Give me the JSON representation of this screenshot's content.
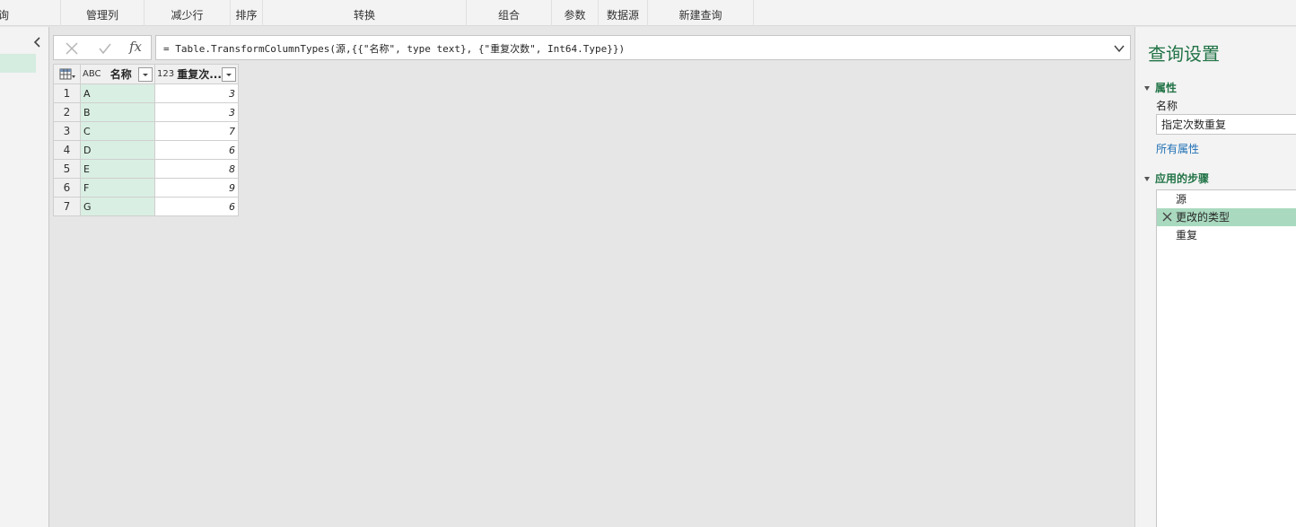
{
  "ribbon": {
    "groups": [
      "询",
      "管理列",
      "减少行",
      "排序",
      "转换",
      "组合",
      "参数",
      "数据源",
      "新建查询"
    ]
  },
  "formula_bar": {
    "formula": "= Table.TransformColumnTypes(源,{{\"名称\", type text}, {\"重复次数\", Int64.Type}})",
    "fx_label": "fx"
  },
  "grid": {
    "columns": [
      {
        "label": "名称",
        "type_icon": "ABC"
      },
      {
        "label": "重复次...",
        "type_icon": "123"
      }
    ],
    "rows": [
      {
        "n": "1",
        "name": "A",
        "count": "3"
      },
      {
        "n": "2",
        "name": "B",
        "count": "3"
      },
      {
        "n": "3",
        "name": "C",
        "count": "7"
      },
      {
        "n": "4",
        "name": "D",
        "count": "6"
      },
      {
        "n": "5",
        "name": "E",
        "count": "8"
      },
      {
        "n": "6",
        "name": "F",
        "count": "9"
      },
      {
        "n": "7",
        "name": "G",
        "count": "6"
      }
    ]
  },
  "settings": {
    "title": "查询设置",
    "properties_header": "属性",
    "name_label": "名称",
    "name_value": "指定次数重复",
    "all_properties_link": "所有属性",
    "steps_header": "应用的步骤",
    "steps": [
      {
        "label": "源",
        "selected": false
      },
      {
        "label": "更改的类型",
        "selected": true
      },
      {
        "label": "重复",
        "selected": false
      }
    ]
  },
  "colors": {
    "accent": "#217346",
    "selected_step": "#a9d9bf",
    "selected_column": "#d9efe3"
  }
}
